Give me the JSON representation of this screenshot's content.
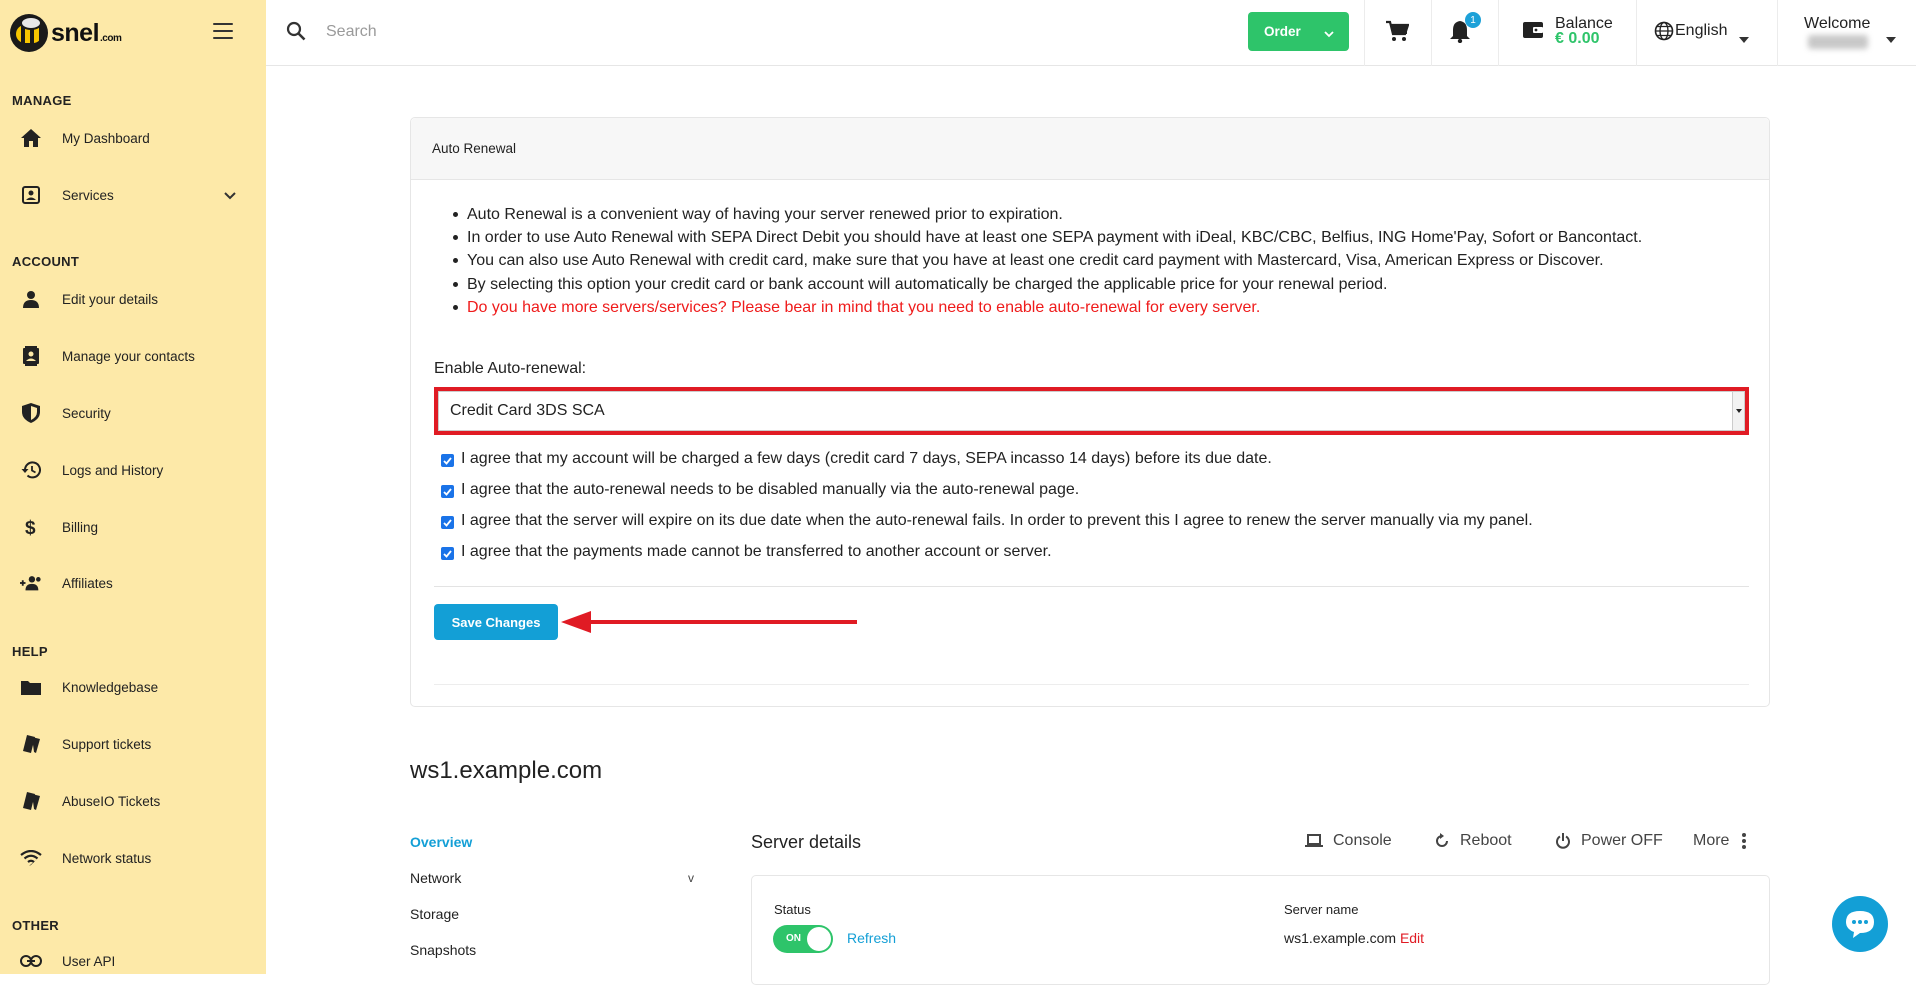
{
  "brand": {
    "logo_text": "snel",
    "logo_suffix": ".com"
  },
  "sidebar": {
    "sections": {
      "manage": "MANAGE",
      "account": "ACCOUNT",
      "help": "HELP",
      "other": "OTHER"
    },
    "items": {
      "dashboard": "My Dashboard",
      "services": "Services",
      "edit_details": "Edit your details",
      "contacts": "Manage your contacts",
      "security": "Security",
      "logs": "Logs and History",
      "billing": "Billing",
      "affiliates": "Affiliates",
      "knowledgebase": "Knowledgebase",
      "support": "Support tickets",
      "abuseio": "AbuseIO Tickets",
      "network": "Network status",
      "user_api": "User API"
    }
  },
  "topbar": {
    "search_placeholder": "Search",
    "order_label": "Order",
    "notification_count": "1",
    "balance_label": "Balance",
    "balance_value": "€ 0.00",
    "language": "English",
    "welcome": "Welcome"
  },
  "auto_renewal": {
    "title": "Auto Renewal",
    "bullets": [
      "Auto Renewal is a convenient way of having your server renewed prior to expiration.",
      "In order to use Auto Renewal with SEPA Direct Debit you should have at least one SEPA payment with iDeal, KBC/CBC, Belfius, ING Home'Pay, Sofort or Bancontact.",
      "You can also use Auto Renewal with credit card, make sure that you have at least one credit card payment with Mastercard, Visa, American Express or Discover.",
      "By selecting this option your credit card or bank account will automatically be charged the applicable price for your renewal period.",
      "Do you have more servers/services? Please bear in mind that you need to enable auto-renewal for every server."
    ],
    "enable_label": "Enable Auto-renewal:",
    "selected_option": "Credit Card 3DS SCA",
    "agreements": [
      "I agree that my account will be charged a few days (credit card 7 days, SEPA incasso 14 days) before its due date.",
      "I agree that the auto-renewal needs to be disabled manually via the auto-renewal page.",
      "I agree that the server will expire on its due date when the auto-renewal fails. In order to prevent this I agree to renew the server manually via my panel.",
      "I agree that the payments made cannot be transferred to another account or server."
    ],
    "save_label": "Save Changes"
  },
  "server": {
    "hostname": "ws1.example.com",
    "subnav": [
      "Overview",
      "Network",
      "Storage",
      "Snapshots"
    ],
    "subnav_chevron": "v",
    "details_title": "Server details",
    "actions": {
      "console": "Console",
      "reboot": "Reboot",
      "power": "Power OFF",
      "more": "More"
    },
    "status_label": "Status",
    "toggle_text": "ON",
    "refresh": "Refresh",
    "server_name_label": "Server name",
    "server_name": "ws1.example.com",
    "edit": "Edit"
  },
  "colors": {
    "sidebar": "#fde9a8",
    "accent": "#139fd6",
    "success": "#2ec46a",
    "danger": "#e01b24"
  }
}
